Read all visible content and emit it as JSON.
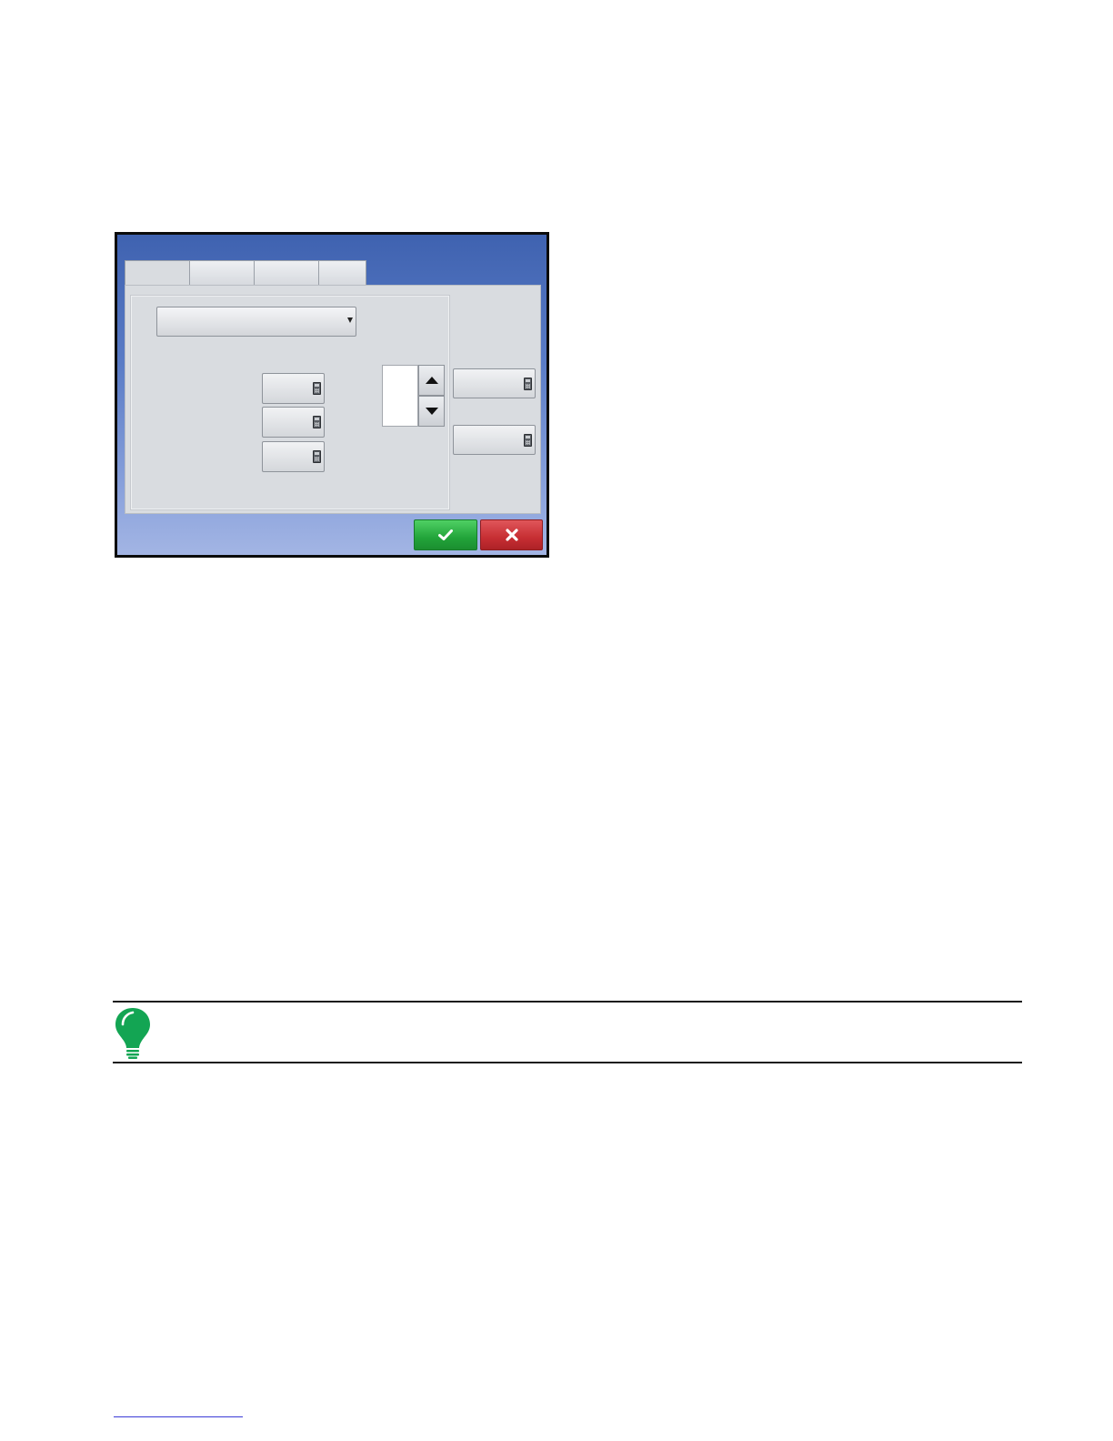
{
  "screen": {
    "tabs": [
      "",
      "",
      "",
      ""
    ],
    "dropdown": {
      "selected": ""
    },
    "fields": [
      "",
      "",
      "",
      "",
      ""
    ],
    "spin_value": "",
    "accept_icon": "checkmark-icon",
    "cancel_icon": "close-icon"
  },
  "note": {
    "icon": "lightbulb-icon",
    "text": ""
  },
  "colors": {
    "titlebar_blue": "#3f62b0",
    "panel_gray": "#d9dce0",
    "accept_green": "#22a43a",
    "cancel_red": "#c62e33",
    "bulb_green": "#13a553"
  }
}
